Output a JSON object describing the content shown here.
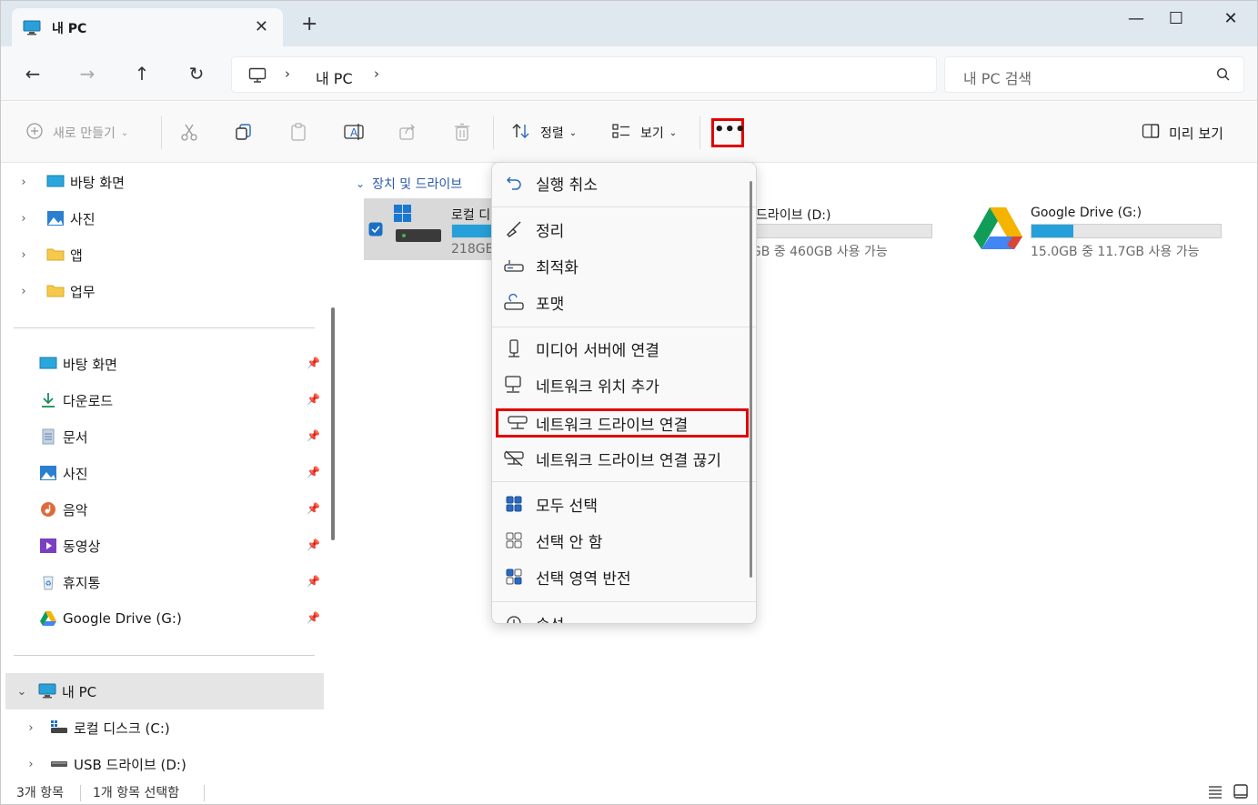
{
  "tab": {
    "title": "내 PC",
    "close": "✕",
    "new": "+"
  },
  "window": {
    "minimize": "—",
    "maximize": "☐",
    "close": "✕"
  },
  "nav": {
    "back": "←",
    "forward": "→",
    "up": "↑",
    "refresh": "↻"
  },
  "address": {
    "crumb": "내 PC",
    "sep": "›"
  },
  "search": {
    "placeholder": "내 PC 검색"
  },
  "command": {
    "new_label": "새로 만들기",
    "sort_label": "정렬",
    "view_label": "보기",
    "more_label": "•••",
    "preview_label": "미리 보기"
  },
  "sidebar": {
    "top_items": [
      {
        "label": "바탕 화면"
      },
      {
        "label": "사진"
      },
      {
        "label": "앱"
      },
      {
        "label": "업무"
      }
    ],
    "quick_items": [
      {
        "label": "바탕 화면"
      },
      {
        "label": "다운로드"
      },
      {
        "label": "문서"
      },
      {
        "label": "사진"
      },
      {
        "label": "음악"
      },
      {
        "label": "동영상"
      },
      {
        "label": "휴지통"
      },
      {
        "label": "Google Drive (G:)"
      }
    ],
    "pc_items": [
      {
        "label": "내 PC"
      },
      {
        "label": "로컬 디스크 (C:)"
      },
      {
        "label": "USB 드라이브 (D:)"
      }
    ]
  },
  "content": {
    "group_label": "장치 및 드라이브",
    "drives": [
      {
        "name": "로컬 디",
        "size": "218GB",
        "used_fraction": 0.55
      },
      {
        "name": "B 드라이브 (D:)",
        "size": "7GB 중 460GB 사용 가능",
        "used_fraction": 0.0
      },
      {
        "name": "Google Drive (G:)",
        "size": "15.0GB 중 11.7GB 사용 가능",
        "used_fraction": 0.22
      }
    ]
  },
  "menu": {
    "items": [
      {
        "label": "실행 취소"
      },
      {
        "label": "정리"
      },
      {
        "label": "최적화"
      },
      {
        "label": "포맷"
      },
      {
        "label": "미디어 서버에 연결"
      },
      {
        "label": "네트워크 위치 추가"
      },
      {
        "label": "네트워크 드라이브 연결"
      },
      {
        "label": "네트워크 드라이브 연결 끊기"
      },
      {
        "label": "모두 선택"
      },
      {
        "label": "선택 안 함"
      },
      {
        "label": "선택 영역 반전"
      },
      {
        "label": "속성"
      }
    ]
  },
  "status": {
    "count": "3개 항목",
    "selected": "1개 항목 선택함"
  },
  "colors": {
    "accent": "#26a0da",
    "highlight_border": "#e00000",
    "titlebar": "#dfe7ef"
  }
}
